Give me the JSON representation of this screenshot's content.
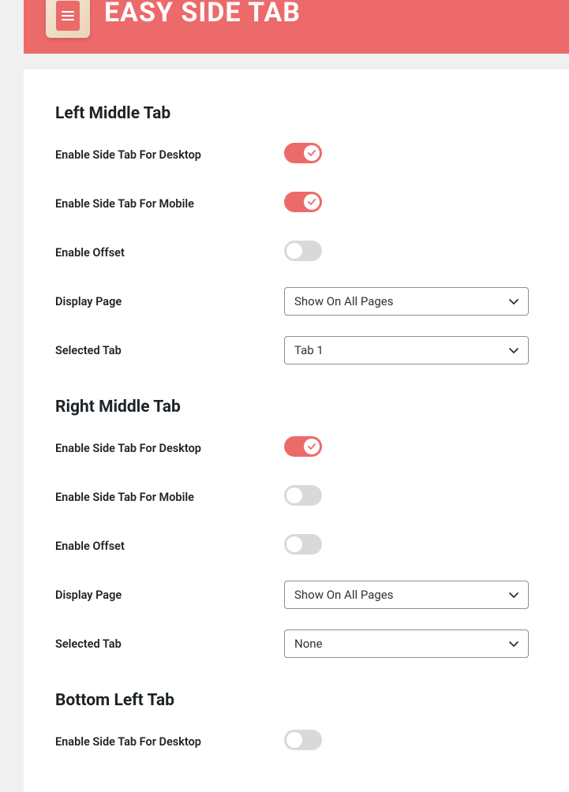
{
  "header": {
    "title": "EASY SIDE TAB"
  },
  "sections": {
    "leftMiddle": {
      "title": "Left Middle Tab",
      "enableDesktop": {
        "label": "Enable Side Tab For Desktop",
        "value": true
      },
      "enableMobile": {
        "label": "Enable Side Tab For Mobile",
        "value": true
      },
      "enableOffset": {
        "label": "Enable Offset",
        "value": false
      },
      "displayPage": {
        "label": "Display Page",
        "value": "Show On All Pages"
      },
      "selectedTab": {
        "label": "Selected Tab",
        "value": "Tab 1"
      }
    },
    "rightMiddle": {
      "title": "Right Middle Tab",
      "enableDesktop": {
        "label": "Enable Side Tab For Desktop",
        "value": true
      },
      "enableMobile": {
        "label": "Enable Side Tab For Mobile",
        "value": false
      },
      "enableOffset": {
        "label": "Enable Offset",
        "value": false
      },
      "displayPage": {
        "label": "Display Page",
        "value": "Show On All Pages"
      },
      "selectedTab": {
        "label": "Selected Tab",
        "value": "None"
      }
    },
    "bottomLeft": {
      "title": "Bottom Left Tab",
      "enableDesktop": {
        "label": "Enable Side Tab For Desktop",
        "value": false
      }
    }
  }
}
